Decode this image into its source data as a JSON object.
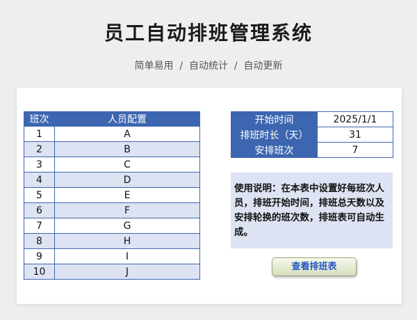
{
  "header": {
    "title": "员工自动排班管理系统",
    "subtitle": "简单易用  /  自动统计  /  自动更新"
  },
  "staff_table": {
    "columns": [
      "班次",
      "人员配置"
    ],
    "rows": [
      {
        "shift": "1",
        "person": "A"
      },
      {
        "shift": "2",
        "person": "B"
      },
      {
        "shift": "3",
        "person": "C"
      },
      {
        "shift": "4",
        "person": "D"
      },
      {
        "shift": "5",
        "person": "E"
      },
      {
        "shift": "6",
        "person": "F"
      },
      {
        "shift": "7",
        "person": "G"
      },
      {
        "shift": "8",
        "person": "H"
      },
      {
        "shift": "9",
        "person": "I"
      },
      {
        "shift": "10",
        "person": "J"
      }
    ]
  },
  "settings": {
    "start_date": {
      "label": "开始时间",
      "value": "2025/1/1"
    },
    "duration": {
      "label": "排班时长（天）",
      "value": "31"
    },
    "shift_count": {
      "label": "安排班次",
      "value": "7"
    }
  },
  "instructions": "使用说明：在本表中设置好每班次人员，排班开始时间，排班总天数以及安排轮换的班次数，排班表可自动生成。",
  "actions": {
    "view_schedule": "查看排班表"
  },
  "colors": {
    "header_blue": "#3d66b0",
    "row_alt": "#dde3f2",
    "button_text": "#2857c5"
  }
}
